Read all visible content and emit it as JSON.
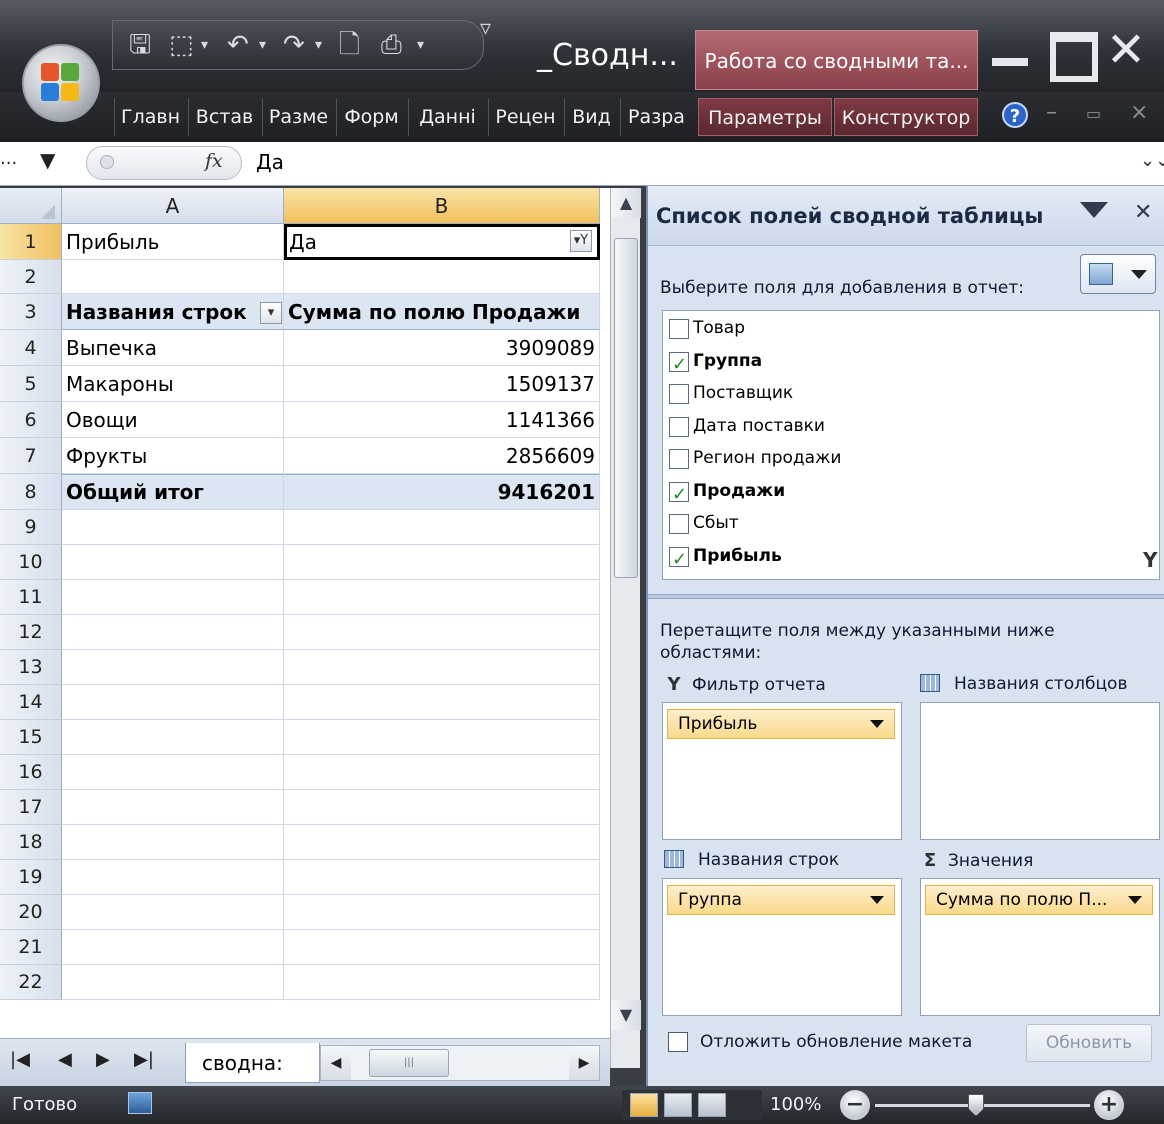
{
  "window": {
    "doc_title": "_Сводн...",
    "context_title": "Работа со сводными та...",
    "qat_separator": "▿"
  },
  "ribbon": {
    "tabs": [
      "Главн",
      "Встав",
      "Разме",
      "Форм",
      "Данні",
      "Рецен",
      "Вид",
      "Разра"
    ],
    "context_tabs": [
      "Параметры",
      "Конструктор"
    ],
    "help": "?"
  },
  "formula_bar": {
    "name_box": "...",
    "fx": "fx",
    "value": "Да"
  },
  "sheet": {
    "columns": [
      "A",
      "B"
    ],
    "rows": [
      "1",
      "2",
      "3",
      "4",
      "5",
      "6",
      "7",
      "8",
      "9",
      "10",
      "11",
      "12",
      "13",
      "14",
      "15",
      "16",
      "17",
      "18",
      "19",
      "20",
      "21",
      "22"
    ],
    "filter_label": "Прибыль",
    "filter_value": "Да",
    "pivot_row_header": "Названия строк",
    "pivot_value_header": "Сумма по полю Продажи",
    "items": [
      {
        "name": "Выпечка",
        "value": "3909089"
      },
      {
        "name": "Макароны",
        "value": "1509137"
      },
      {
        "name": "Овощи",
        "value": "1141366"
      },
      {
        "name": "Фрукты",
        "value": "2856609"
      }
    ],
    "total_label": "Общий итог",
    "total_value": "9416201",
    "sheet_tab": "сводна:"
  },
  "status": {
    "text": "Готово",
    "zoom": "100%"
  },
  "field_list": {
    "title": "Список полей сводной таблицы",
    "choose_label": "Выберите поля для добавления в отчет:",
    "fields": [
      {
        "label": "Товар",
        "checked": false
      },
      {
        "label": "Группа",
        "checked": true
      },
      {
        "label": "Поставщик",
        "checked": false
      },
      {
        "label": "Дата поставки",
        "checked": false
      },
      {
        "label": "Регион продажи",
        "checked": false
      },
      {
        "label": "Продажи",
        "checked": true
      },
      {
        "label": "Сбыт",
        "checked": false
      },
      {
        "label": "Прибыль",
        "checked": true
      }
    ],
    "drag_label": "Перетащите поля между указанными ниже областями:",
    "report_filter": "Фильтр отчета",
    "column_labels": "Названия столбцов",
    "row_labels": "Названия строк",
    "values": "Значения",
    "filter_chip": "Прибыль",
    "row_chip": "Группа",
    "values_chip": "Сумма по полю П...",
    "defer_label": "Отложить обновление макета",
    "update_button": "Обновить"
  }
}
